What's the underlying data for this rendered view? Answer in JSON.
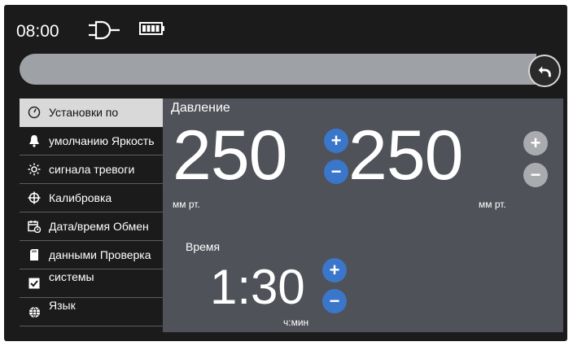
{
  "status": {
    "time": "08:00",
    "power_icon": "plug-icon",
    "battery_icon": "battery-icon"
  },
  "toolbar": {
    "back_icon": "back-arrow-icon"
  },
  "sidebar": {
    "items": [
      {
        "label": "Установки по",
        "icon": "gauge-icon",
        "active": true
      },
      {
        "label": "умолчанию Яркость",
        "icon": "bell-icon"
      },
      {
        "label": "сигнала тревоги",
        "icon": "brightness-icon"
      },
      {
        "label": "Калибровка",
        "icon": "crosshair-icon"
      },
      {
        "label": "Дата/время Обмен",
        "icon": "calendar-clock-icon"
      },
      {
        "label": "данными Проверка",
        "icon": "sd-card-icon"
      },
      {
        "label": "системы",
        "icon": "checkbox-icon"
      },
      {
        "label": "Язык",
        "icon": "globe-icon"
      }
    ]
  },
  "pressure": {
    "title": "Давление",
    "value_left": "250",
    "value_right": "250",
    "unit_left": "мм рт.",
    "unit_right": "мм рт.",
    "plus": "+",
    "minus": "−"
  },
  "time_setting": {
    "title": "Время",
    "value": "1:30",
    "unit": "ч:мин",
    "plus": "+",
    "minus": "−"
  },
  "colors": {
    "accent": "#3a76c9",
    "panel": "#4f5258",
    "background": "#1b1b1b"
  }
}
